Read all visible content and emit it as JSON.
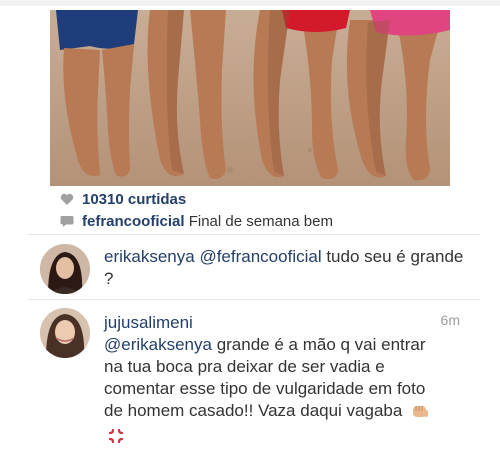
{
  "post": {
    "likes": "10310 curtidas",
    "caption_author": "fefrancooficial",
    "caption_text": "Final de semana bem"
  },
  "comments": [
    {
      "username": "erikaksenya",
      "mention": "@fefrancooficial",
      "text": " tudo seu é grande ?",
      "time": ""
    },
    {
      "username": "jujusalimeni",
      "mention": "@erikaksenya",
      "text": " grande é a mão q vai entrar na tua boca pra deixar de ser vadia e comentar esse tipo de vulgaridade em foto de homem casado!! Vaza daqui vagaba",
      "time": "6m"
    }
  ],
  "icons": {
    "like": "heart-icon",
    "caption": "speech-bubble-icon",
    "emoji_1": "fist-icon",
    "emoji_2": "anger-symbol-icon"
  },
  "colors": {
    "username": "#233f6a",
    "text": "#333333",
    "timestamp": "#9a9a9a"
  }
}
